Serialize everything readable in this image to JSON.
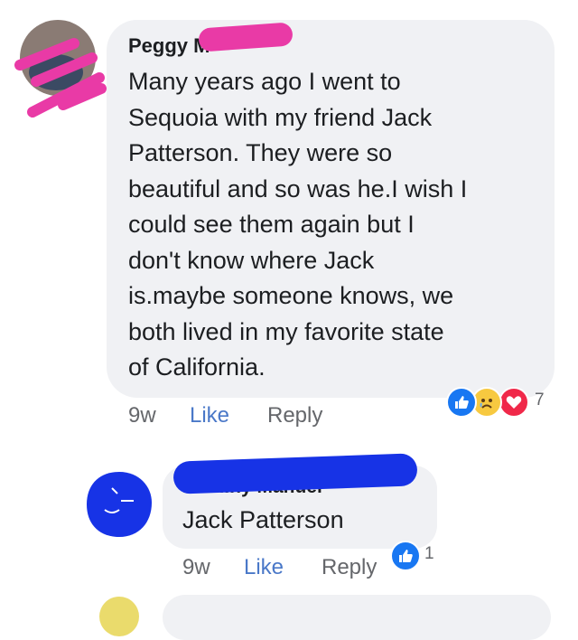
{
  "comments": [
    {
      "author": "Peggy M",
      "text": "Many years ago I went to\nSequoia with my friend Jack\nPatterson. They were so\nbeautiful and so was he.I wish I\ncould see them again but I\ndon't know where Jack\nis.maybe someone knows, we\nboth lived in my favorite state\nof California.",
      "time": "9w",
      "like_label": "Like",
      "reply_label": "Reply",
      "reactions": [
        "like-icon",
        "sad-icon",
        "love-icon"
      ],
      "reaction_count": "7"
    },
    {
      "author": "P... ...ny Manuel",
      "text": "Jack Patterson",
      "time": "9w",
      "like_label": "Like",
      "reply_label": "Reply",
      "reactions": [
        "like-icon"
      ],
      "reaction_count": "1"
    }
  ],
  "colors": {
    "bubble": "#f0f1f4",
    "like_link": "#4a78c8",
    "muted": "#65676b",
    "fb_blue": "#1877f2",
    "love": "#f02849",
    "sad": "#f7c940",
    "redact_pink": "#e93aa6",
    "redact_blue": "#1733e6"
  }
}
